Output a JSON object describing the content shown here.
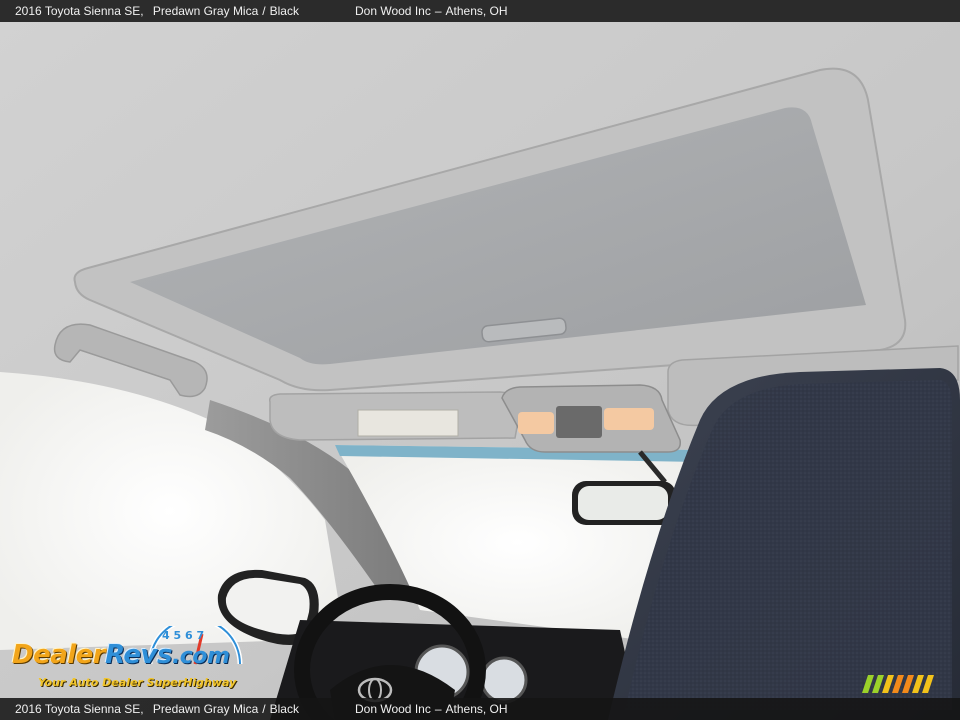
{
  "caption": {
    "vehicle": "2016 Toyota Sienna SE",
    "color_exterior": "Predawn Gray Mica",
    "separator": "/",
    "color_interior": "Black",
    "dealer": "Don Wood Inc",
    "dash": "–",
    "location": "Athens, OH"
  },
  "watermark": {
    "brand_left": "Dealer",
    "brand_right": "Revs",
    "brand_suffix": ".com",
    "tagline": "Your Auto Dealer SuperHighway",
    "gauge_digits": [
      "4",
      "5",
      "6",
      "7"
    ]
  },
  "colors": {
    "headliner": "#c9c9c9",
    "sunshade": "#a7a9ab",
    "seat": "#2f3542",
    "window_glow": "#f7f7f5",
    "brand_orange": "#f2a51a",
    "brand_blue": "#2f8fd8",
    "stripe_colors": [
      "#9bd12a",
      "#f2c21a",
      "#f28a1a",
      "#f2c21a"
    ]
  },
  "icons": {
    "steering_logo": "toyota-emblem-icon",
    "mirror": "rearview-mirror",
    "overhead_console": "overhead-dome-light"
  }
}
